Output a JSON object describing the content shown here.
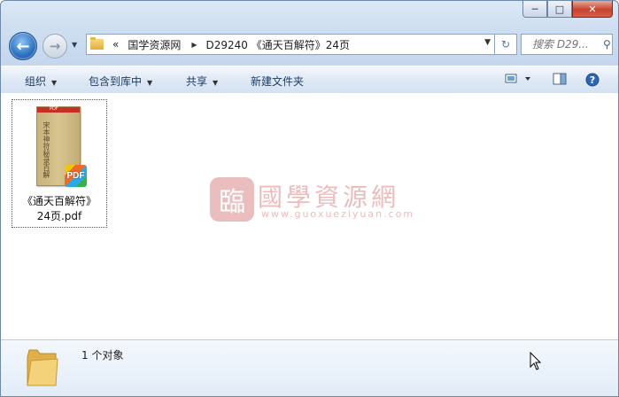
{
  "window": {
    "caption": {
      "minimize": "─",
      "maximize": "□",
      "close": "✕"
    }
  },
  "nav": {
    "back_icon": "back-arrow-icon",
    "forward_icon": "forward-arrow-icon",
    "back_glyph": "←",
    "forward_glyph": "→",
    "history_glyph": "▼"
  },
  "address": {
    "overflow": "«",
    "crumbs": [
      "国学资源网",
      "D29240 《通天百解符》24页"
    ],
    "separator": "▶",
    "dropdown_glyph": "▼",
    "refresh_glyph": "↻"
  },
  "search": {
    "placeholder": "搜索 D29...",
    "icon": "search-icon",
    "glyph": "⚲"
  },
  "toolbar": {
    "organize": "组织",
    "include_in_library": "包含到库中",
    "share": "共享",
    "new_folder": "新建文件夹",
    "arrow": "▼"
  },
  "files": [
    {
      "name": "《通天百解符》24页.pdf",
      "name_line1": "《通天百解符》",
      "name_line2": "24页.pdf",
      "cover_text": "宋本神符秘录百解",
      "band_text": "PDF",
      "badge": "PDF"
    }
  ],
  "watermark": {
    "logo_char": "臨",
    "title": "國學資源網",
    "url": "www.guoxueziyuan.com"
  },
  "details": {
    "count": "1 个对象"
  },
  "colors": {
    "accent": "#2a6fc0",
    "close": "#c7432e",
    "watermark": "#ecbcbc"
  }
}
